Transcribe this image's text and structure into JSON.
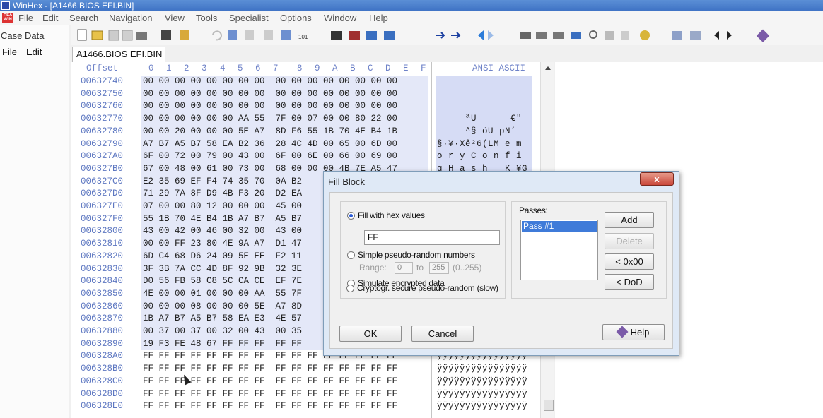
{
  "window": {
    "title": "WinHex - [A1466.BIOS EFI.BIN]"
  },
  "menubar": {
    "items": [
      "File",
      "Edit",
      "Search",
      "Navigation",
      "View",
      "Tools",
      "Specialist",
      "Options",
      "Window",
      "Help"
    ]
  },
  "left_pane": {
    "title": "Case Data",
    "menu": [
      "File",
      "Edit"
    ]
  },
  "toolbar": {
    "icons": [
      "new-file-icon",
      "open-file-icon",
      "save-icon",
      "save-as-icon",
      "print-icon",
      "properties-icon",
      "run-icon",
      "undo-icon",
      "copy-icon",
      "paste-icon",
      "paste-special-icon",
      "copy-block-icon",
      "hex-convert-icon",
      "find-icon",
      "find-hex-icon",
      "replace-icon",
      "replace-hex-icon",
      "goto-offset-icon",
      "goto-mark-icon",
      "back-icon",
      "forward-icon",
      "disk-icon",
      "disk-open-icon",
      "disk-clone-icon",
      "ram-icon",
      "search-disk-icon",
      "hand-icon",
      "calc-icon",
      "compare-icon",
      "list-icon",
      "previous-icon",
      "next-mark-icon",
      "help-book-icon"
    ]
  },
  "tab": {
    "label": "A1466.BIOS EFI.BIN"
  },
  "hex_view": {
    "header_offset": "Offset",
    "header_cols": [
      "0",
      "1",
      "2",
      "3",
      "4",
      "5",
      "6",
      "7",
      "8",
      "9",
      "A",
      "B",
      "C",
      "D",
      "E",
      "F"
    ],
    "header_ascii": "ANSI ASCII",
    "rows": [
      {
        "offset": "00632740",
        "hex": "00 00 00 00 00 00 00 00  00 00 00 00 00 00 00 00",
        "ascii": ""
      },
      {
        "offset": "00632750",
        "hex": "00 00 00 00 00 00 00 00  00 00 00 00 00 00 00 00",
        "ascii": ""
      },
      {
        "offset": "00632760",
        "hex": "00 00 00 00 00 00 00 00  00 00 00 00 00 00 00 00",
        "ascii": ""
      },
      {
        "offset": "00632770",
        "hex": "00 00 00 00 00 00 AA 55  7F 00 07 00 00 80 22 00",
        "ascii": "     ªU      €\""
      },
      {
        "offset": "00632780",
        "hex": "00 00 20 00 00 00 5E A7  8D F6 55 1B 70 4E B4 1B",
        "ascii": "     ^§ öU pN´"
      },
      {
        "offset": "00632790",
        "hex": "A7 B7 A5 B7 58 EA B2 36  28 4C 4D 00 65 00 6D 00",
        "ascii": "§·¥·Xê²6(LM e m"
      },
      {
        "offset": "006327A0",
        "hex": "6F 00 72 00 79 00 43 00  6F 00 6E 00 66 00 69 00",
        "ascii": "o r y C o n f i"
      },
      {
        "offset": "006327B0",
        "hex": "67 00 48 00 61 00 73 00  68 00 00 00 4B 7E A5 47",
        "ascii": "g H a s h   K ¥G"
      },
      {
        "offset": "006327C0",
        "hex": "E2 35 69 EF F4 74 35 70  0A B2",
        "ascii": ""
      },
      {
        "offset": "006327D0",
        "hex": "71 29 7A 8F D9 4B F3 20  D2 EA",
        "ascii": ""
      },
      {
        "offset": "006327E0",
        "hex": "07 00 00 80 12 00 00 00  45 00",
        "ascii": ""
      },
      {
        "offset": "006327F0",
        "hex": "55 1B 70 4E B4 1B A7 B7  A5 B7",
        "ascii": ""
      },
      {
        "offset": "00632800",
        "hex": "43 00 42 00 46 00 32 00  43 00",
        "ascii": ""
      },
      {
        "offset": "00632810",
        "hex": "00 00 FF 23 80 4E 9A A7  D1 47",
        "ascii": ""
      },
      {
        "offset": "00632820",
        "hex": "6D C4 68 D6 24 09 5E EE  F2 11",
        "ascii": ""
      },
      {
        "offset": "00632830",
        "hex": "3F 3B 7A CC 4D 8F 92 9B  32 3E",
        "ascii": ""
      },
      {
        "offset": "00632840",
        "hex": "D0 56 FB 58 C8 5C CA CE  EF 7E",
        "ascii": ""
      },
      {
        "offset": "00632850",
        "hex": "4E 00 00 01 00 00 00 AA  55 7F",
        "ascii": ""
      },
      {
        "offset": "00632860",
        "hex": "00 00 00 08 00 00 00 5E  A7 8D",
        "ascii": ""
      },
      {
        "offset": "00632870",
        "hex": "1B A7 B7 A5 B7 58 EA E3  4E 57",
        "ascii": ""
      },
      {
        "offset": "00632880",
        "hex": "00 37 00 37 00 32 00 43  00 35",
        "ascii": ""
      },
      {
        "offset": "00632890",
        "hex": "19 F3 FE 48 67 FF FF FF  FF FF",
        "ascii": ""
      },
      {
        "offset": "006328A0",
        "hex": "FF FF FF FF FF FF FF FF  FF FF FF FF FF FF FF FF",
        "ascii": "ÿÿÿÿÿÿÿÿÿÿÿÿÿÿÿÿ"
      },
      {
        "offset": "006328B0",
        "hex": "FF FF FF FF FF FF FF FF  FF FF FF FF FF FF FF FF",
        "ascii": "ÿÿÿÿÿÿÿÿÿÿÿÿÿÿÿÿ"
      },
      {
        "offset": "006328C0",
        "hex": "FF FF FF FF FF FF FF FF  FF FF FF FF FF FF FF FF",
        "ascii": "ÿÿÿÿÿÿÿÿÿÿÿÿÿÿÿÿ"
      },
      {
        "offset": "006328D0",
        "hex": "FF FF FF FF FF FF FF FF  FF FF FF FF FF FF FF FF",
        "ascii": "ÿÿÿÿÿÿÿÿÿÿÿÿÿÿÿÿ"
      },
      {
        "offset": "006328E0",
        "hex": "FF FF FF FF FF FF FF FF  FF FF FF FF FF FF FF FF",
        "ascii": "ÿÿÿÿÿÿÿÿÿÿÿÿÿÿÿÿ"
      }
    ]
  },
  "dialog": {
    "title": "Fill Block",
    "close_label": "x",
    "options": [
      {
        "label": "Fill with hex values",
        "selected": true
      },
      {
        "label": "Simple pseudo-random numbers",
        "selected": false
      },
      {
        "label": "Simulate encrypted data",
        "selected": false
      },
      {
        "label": "Cryptogr. secure pseudo-random (slow)",
        "selected": false
      }
    ],
    "hex_value": "FF",
    "range_label": "Range:",
    "range_from": "0",
    "range_to_label": "to",
    "range_to": "255",
    "range_hint": "(0..255)",
    "passes_label": "Passes:",
    "passes": [
      "Pass #1"
    ],
    "add_button": "Add",
    "delete_button": "Delete",
    "x00_button": "< 0x00",
    "dod_button": "< DoD",
    "ok_button": "OK",
    "cancel_button": "Cancel",
    "help_button": "Help"
  },
  "colors": {
    "offset": "#5d77c1",
    "selection": "#e4e8f8",
    "dialog_bg": "#dfe9f6",
    "pass_highlight": "#3f7bd9"
  }
}
